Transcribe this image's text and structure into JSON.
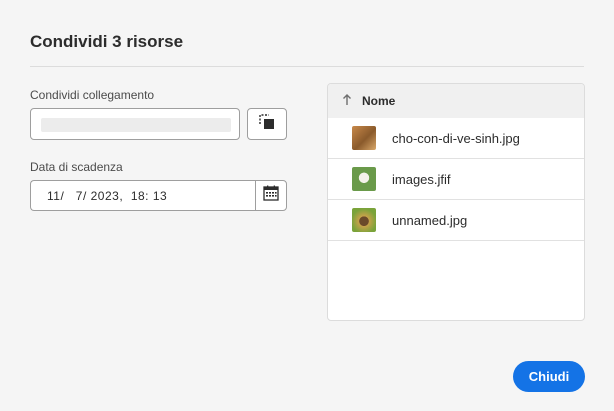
{
  "dialog": {
    "title": "Condividi 3 risorse"
  },
  "share_link": {
    "label": "Condividi collegamento",
    "value": "",
    "copy_icon": "copy-icon"
  },
  "expiry": {
    "label": "Data di scadenza",
    "value": "11/   7/ 2023,  18: 13",
    "calendar_icon": "calendar-icon"
  },
  "file_list": {
    "sort_icon": "sort-ascending-icon",
    "header": "Nome",
    "items": [
      {
        "name": "cho-con-di-ve-sinh.jpg",
        "thumb": "image-thumbnail"
      },
      {
        "name": "images.jfif",
        "thumb": "image-thumbnail"
      },
      {
        "name": "unnamed.jpg",
        "thumb": "image-thumbnail"
      }
    ]
  },
  "footer": {
    "close_label": "Chiudi"
  },
  "colors": {
    "accent": "#1473e6",
    "background": "#f5f5f5"
  }
}
